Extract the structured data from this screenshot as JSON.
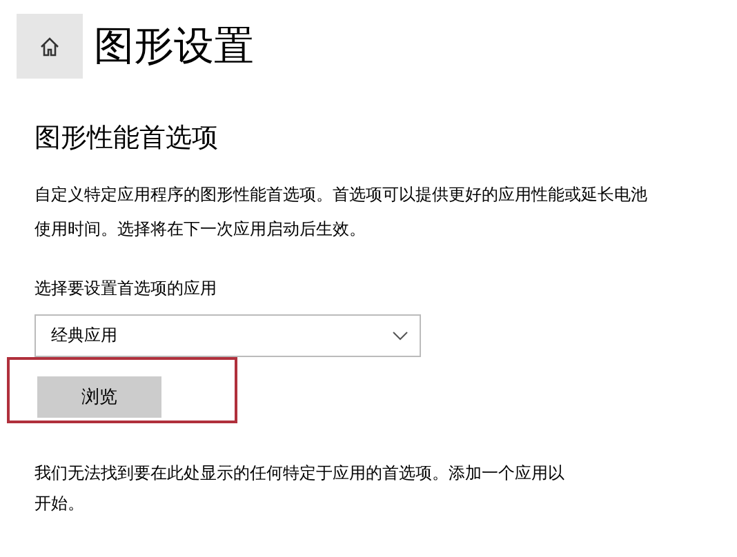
{
  "page": {
    "title": "图形设置"
  },
  "section": {
    "heading": "图形性能首选项",
    "description": "自定义特定应用程序的图形性能首选项。首选项可以提供更好的应用性能或延长电池使用时间。选择将在下一次应用启动后生效。"
  },
  "app_picker": {
    "label": "选择要设置首选项的应用",
    "value": "经典应用"
  },
  "browse_button": {
    "label": "浏览",
    "highlighted": true
  },
  "empty_message": "我们无法找到要在此处显示的任何特定于应用的首选项。添加一个应用以开始。"
}
